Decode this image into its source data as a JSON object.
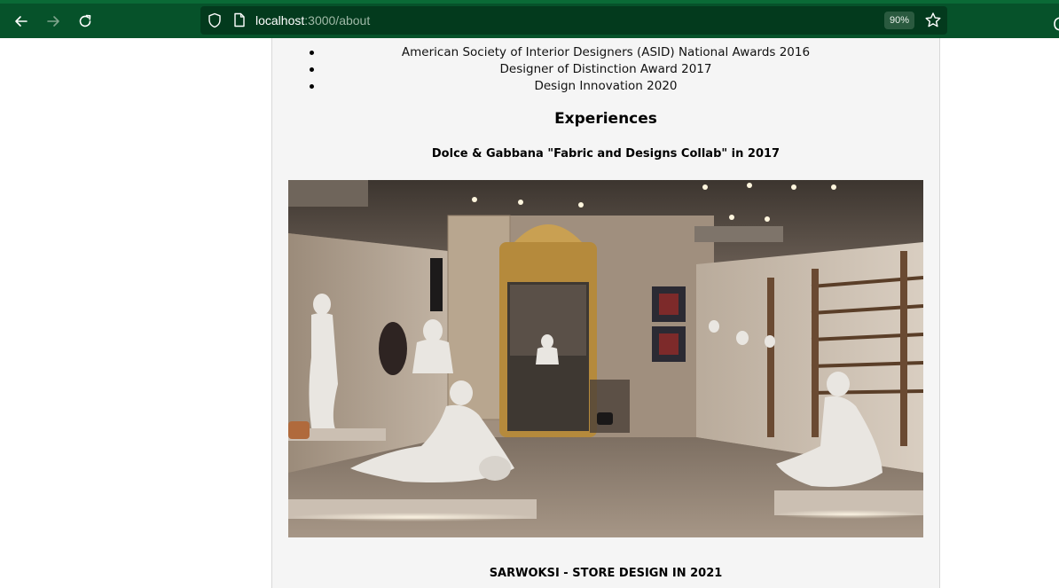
{
  "browser": {
    "url_host": "localhost",
    "url_path": ":3000/about",
    "zoom": "90%",
    "chrome_color": "#06522a",
    "icons": [
      "back-arrow-icon",
      "forward-arrow-icon",
      "reload-icon",
      "shield-icon",
      "page-icon",
      "star-icon"
    ]
  },
  "page": {
    "awards": [
      "American Society of Interior Designers (ASID) National Awards 2016",
      "Designer of Distinction Award 2017",
      "Design Innovation 2020"
    ],
    "experiences_heading": "Experiences",
    "experiences": [
      {
        "title": "Dolce & Gabbana \"Fabric and Designs Collab\" in 2017"
      },
      {
        "title": "SARWOKSI - STORE DESIGN IN 2021"
      }
    ]
  }
}
